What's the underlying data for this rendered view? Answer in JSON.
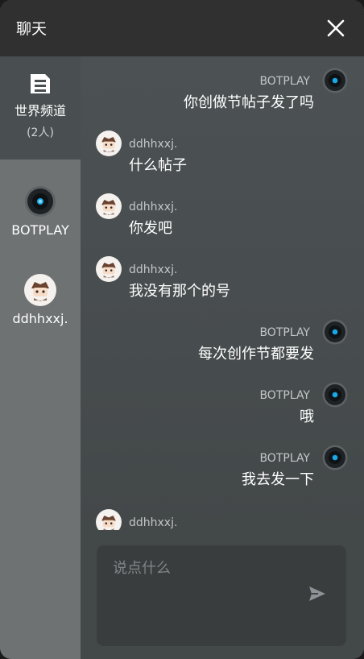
{
  "header": {
    "title": "聊天"
  },
  "sidebar": {
    "channel": {
      "name": "世界频道",
      "count": "(2人)"
    },
    "users": [
      {
        "name": "BOTPLAY",
        "avatar": "robot-eye-avatar"
      },
      {
        "name": "ddhhxxj.",
        "avatar": "chibi-character-avatar"
      }
    ]
  },
  "messages": [
    {
      "side": "right",
      "name": "BOTPLAY",
      "text": "你创做节帖子发了吗",
      "avatar": "robot-eye-avatar"
    },
    {
      "side": "left",
      "name": "ddhhxxj.",
      "text": "什么帖子",
      "avatar": "chibi-character-avatar"
    },
    {
      "side": "left",
      "name": "ddhhxxj.",
      "text": "你发吧",
      "avatar": "chibi-character-avatar"
    },
    {
      "side": "left",
      "name": "ddhhxxj.",
      "text": "我没有那个的号",
      "avatar": "chibi-character-avatar"
    },
    {
      "side": "right",
      "name": "BOTPLAY",
      "text": "每次创作节都要发",
      "avatar": "robot-eye-avatar"
    },
    {
      "side": "right",
      "name": "BOTPLAY",
      "text": "哦",
      "avatar": "robot-eye-avatar"
    },
    {
      "side": "right",
      "name": "BOTPLAY",
      "text": "我去发一下",
      "avatar": "robot-eye-avatar"
    },
    {
      "side": "left",
      "name": "ddhhxxj.",
      "text": "",
      "avatar": "chibi-character-avatar"
    }
  ],
  "composer": {
    "placeholder": "说点什么"
  },
  "colors": {
    "header_bg": "#2f302f",
    "sidebar_bg": "#6e7272",
    "chat_bg": "#4a4f51",
    "input_bg": "#3a3d3e",
    "robot_eye": "#19a9e6"
  }
}
